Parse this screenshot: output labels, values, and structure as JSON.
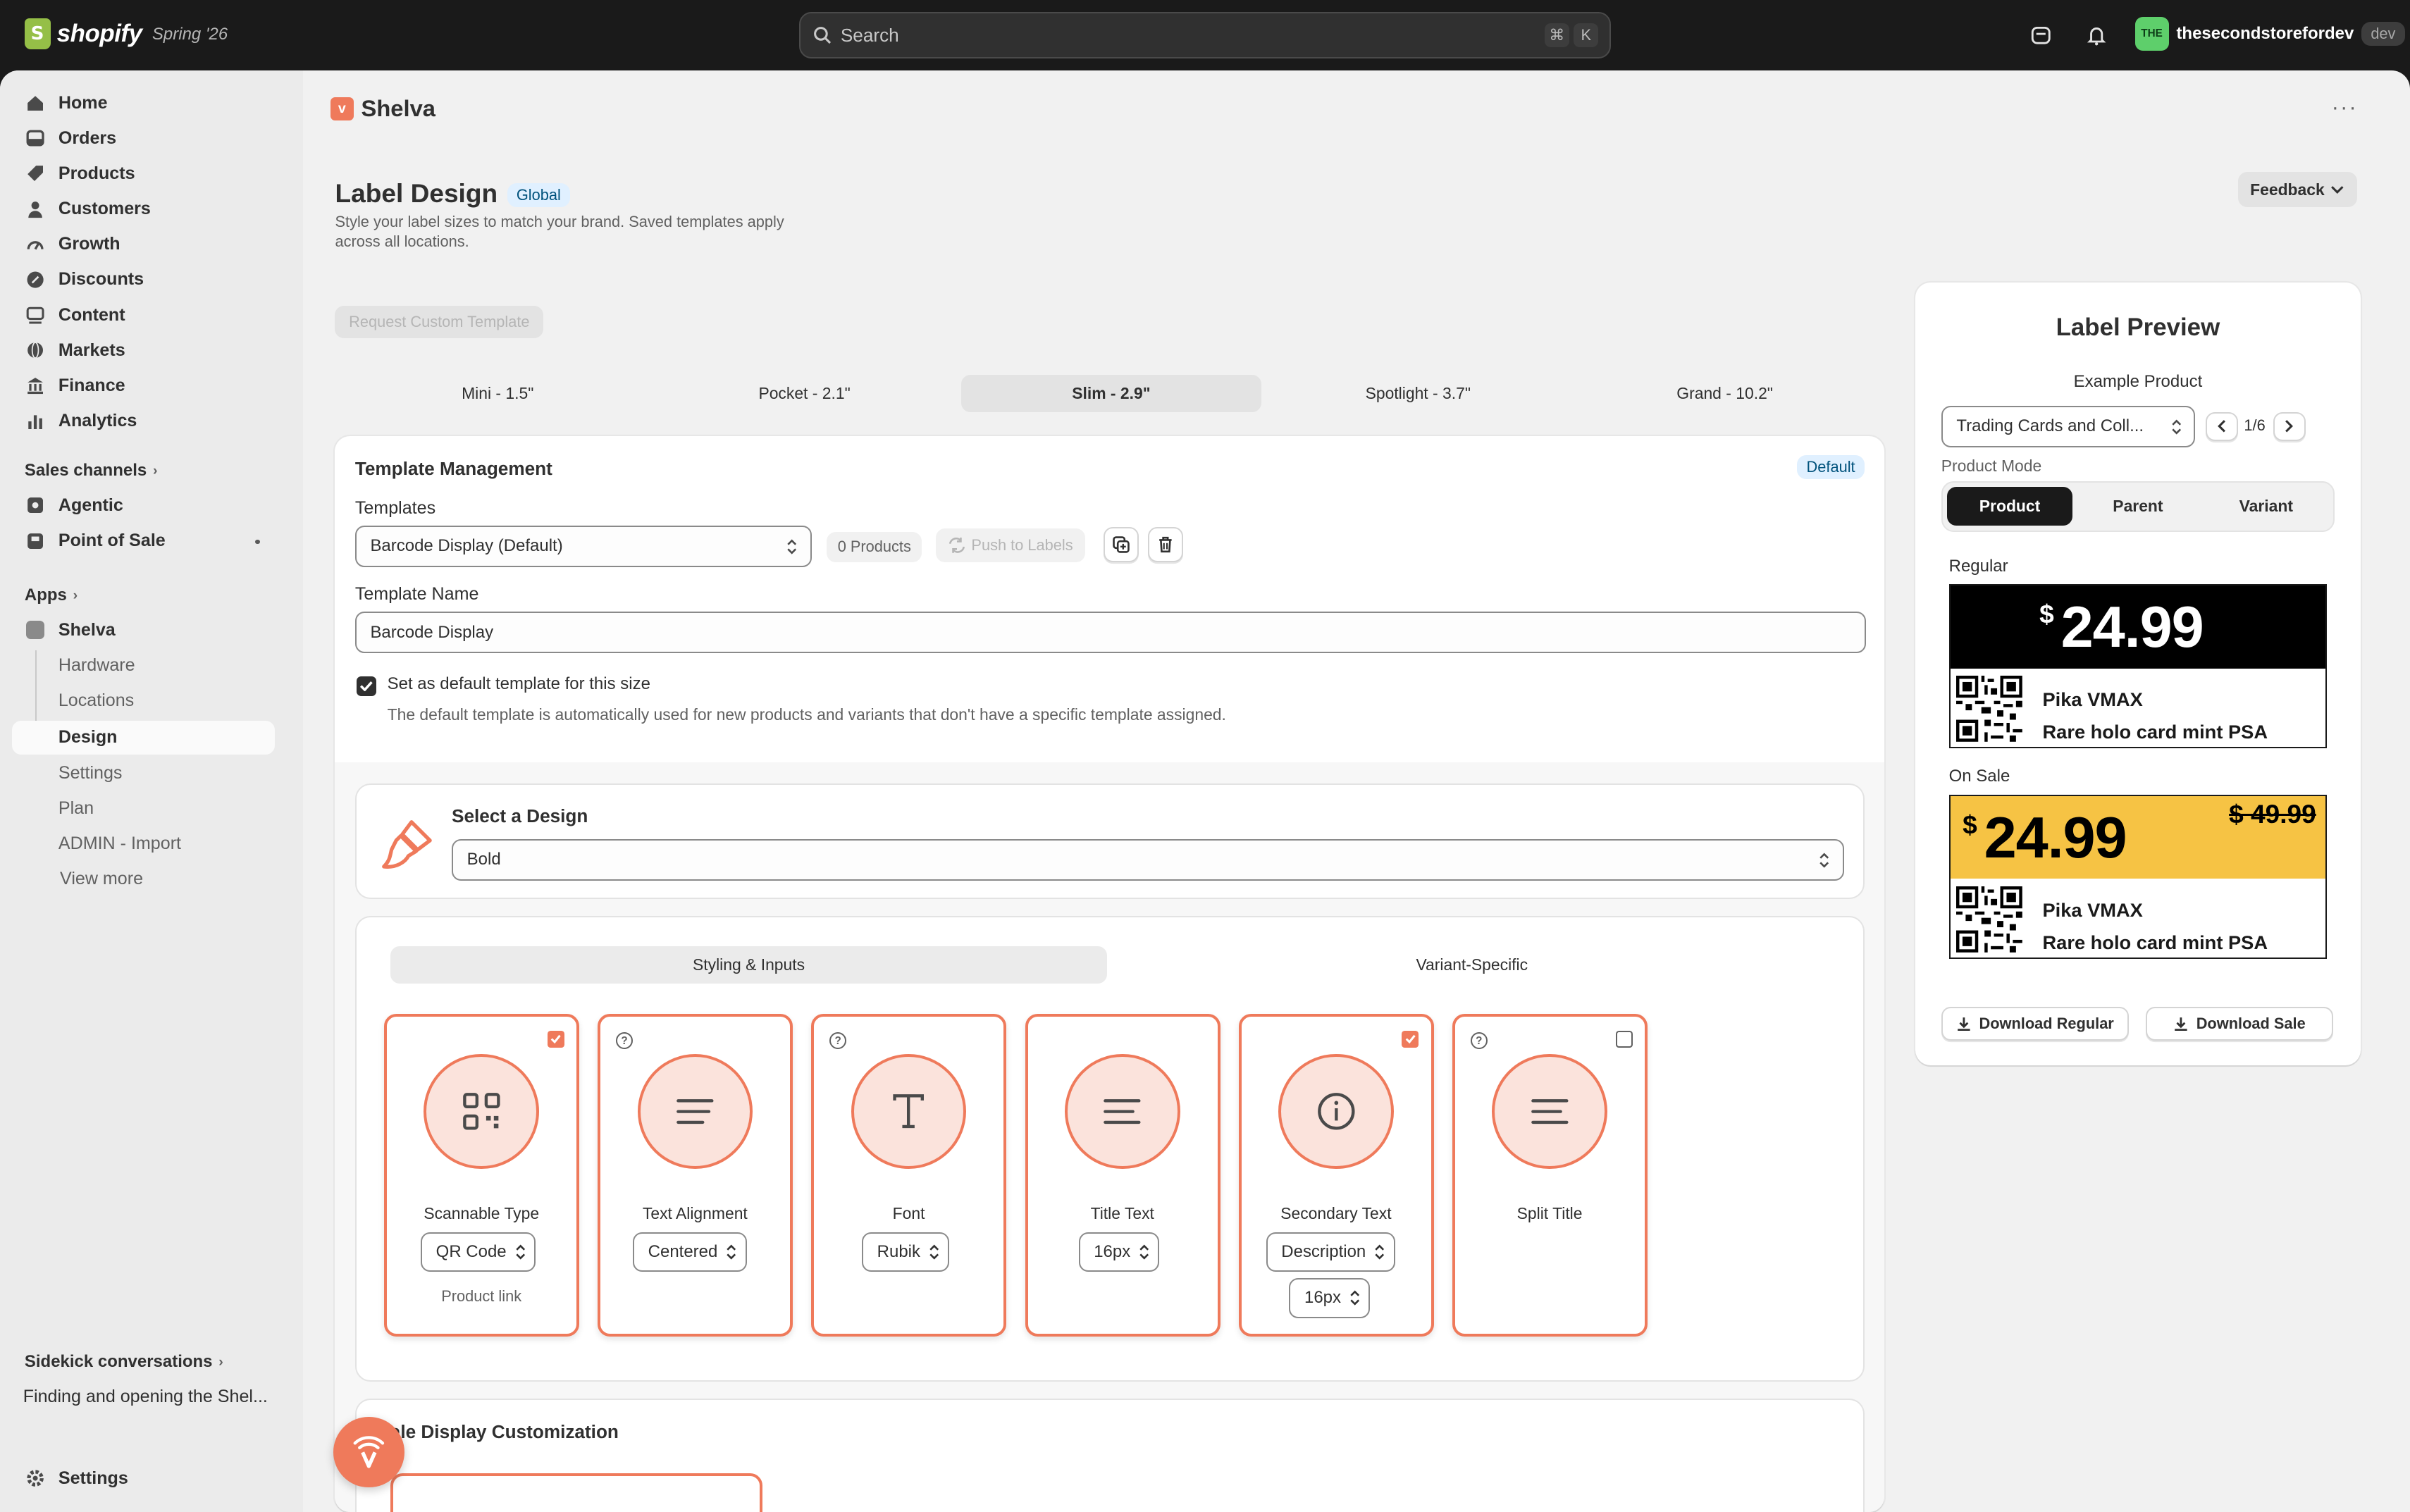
{
  "topbar": {
    "logo_text": "shopify",
    "edition": "Spring '26",
    "search_placeholder": "Search",
    "kbd_cmd": "⌘",
    "kbd_k": "K",
    "store_initials": "THE",
    "store_name": "thesecondstorefordev",
    "store_tag": "dev"
  },
  "sidebar": {
    "items": [
      {
        "label": "Home",
        "icon": "home-icon"
      },
      {
        "label": "Orders",
        "icon": "inbox-icon"
      },
      {
        "label": "Products",
        "icon": "tag-icon"
      },
      {
        "label": "Customers",
        "icon": "person-icon"
      },
      {
        "label": "Growth",
        "icon": "gauge-icon"
      },
      {
        "label": "Discounts",
        "icon": "discount-icon"
      },
      {
        "label": "Content",
        "icon": "content-icon"
      },
      {
        "label": "Markets",
        "icon": "globe-icon"
      },
      {
        "label": "Finance",
        "icon": "bank-icon"
      },
      {
        "label": "Analytics",
        "icon": "chart-icon"
      }
    ],
    "sales_channels_heading": "Sales channels",
    "channels": [
      {
        "label": "Agentic"
      },
      {
        "label": "Point of Sale"
      }
    ],
    "apps_heading": "Apps",
    "app_name": "Shelva",
    "app_sub": [
      {
        "label": "Hardware"
      },
      {
        "label": "Locations"
      },
      {
        "label": "Design"
      },
      {
        "label": "Settings"
      },
      {
        "label": "Plan"
      },
      {
        "label": "ADMIN - Import"
      }
    ],
    "view_more": "View more",
    "sidekick_heading": "Sidekick conversations",
    "sidekick_item": "Finding and opening the Shel...",
    "settings": "Settings"
  },
  "app_header": {
    "title": "Shelva",
    "logo_glyph": "v"
  },
  "page": {
    "title": "Label Design",
    "badge": "Global",
    "subtitle": "Style your label sizes to match your brand. Saved templates apply across all locations.",
    "feedback": "Feedback",
    "request_btn": "Request Custom Template",
    "size_tabs": [
      "Mini - 1.5\"",
      "Pocket - 2.1\"",
      "Slim - 2.9\"",
      "Spotlight - 3.7\"",
      "Grand - 10.2\""
    ],
    "active_size": "Slim - 2.9\""
  },
  "template_mgmt": {
    "title": "Template Management",
    "badge": "Default",
    "templates_label": "Templates",
    "template_selected": "Barcode Display (Default)",
    "products_chip": "0 Products",
    "push_btn": "Push to Labels",
    "name_label": "Template Name",
    "name_value": "Barcode Display",
    "default_check_label": "Set as default template for this size",
    "default_help": "The default template is automatically used for new products and variants that don't have a specific template assigned.",
    "default_checked": true
  },
  "design": {
    "label": "Select a Design",
    "selected": "Bold"
  },
  "styling": {
    "tabs": [
      "Styling & Inputs",
      "Variant-Specific"
    ],
    "active_tab": "Styling & Inputs",
    "options": [
      {
        "title": "Scannable Type",
        "value": "QR Code",
        "help": "Product link",
        "checked": true,
        "icon": "qr-code-icon"
      },
      {
        "title": "Text Alignment",
        "value": "Centered",
        "icon": "align-center-icon"
      },
      {
        "title": "Font",
        "value": "Rubik",
        "icon": "font-icon"
      },
      {
        "title": "Title Text",
        "value": "16px",
        "icon": "text-lines-icon"
      },
      {
        "title": "Secondary Text",
        "value": "Description",
        "value2": "16px",
        "checked": true,
        "icon": "info-icon"
      },
      {
        "title": "Split Title",
        "checked": false,
        "icon": "text-lines-icon"
      }
    ]
  },
  "sale_display": {
    "title": "Sale Display Customization"
  },
  "preview": {
    "title": "Label Preview",
    "example_label": "Example Product",
    "product_select": "Trading Cards and Coll...",
    "counter": "1/6",
    "mode_label": "Product Mode",
    "modes": [
      "Product",
      "Parent",
      "Variant"
    ],
    "active_mode": "Product",
    "regular_label": "Regular",
    "sale_label": "On Sale",
    "currency": "$",
    "price": "24.99",
    "old_price": "$ 49.99",
    "product_line1": "Pika VMAX",
    "product_line2": "Rare holo card mint PSA",
    "download_regular": "Download Regular",
    "download_sale": "Download Sale"
  },
  "colors": {
    "accent": "#ef7a5b",
    "sale_bg": "#f6c344",
    "regular_bg": "#000000"
  }
}
